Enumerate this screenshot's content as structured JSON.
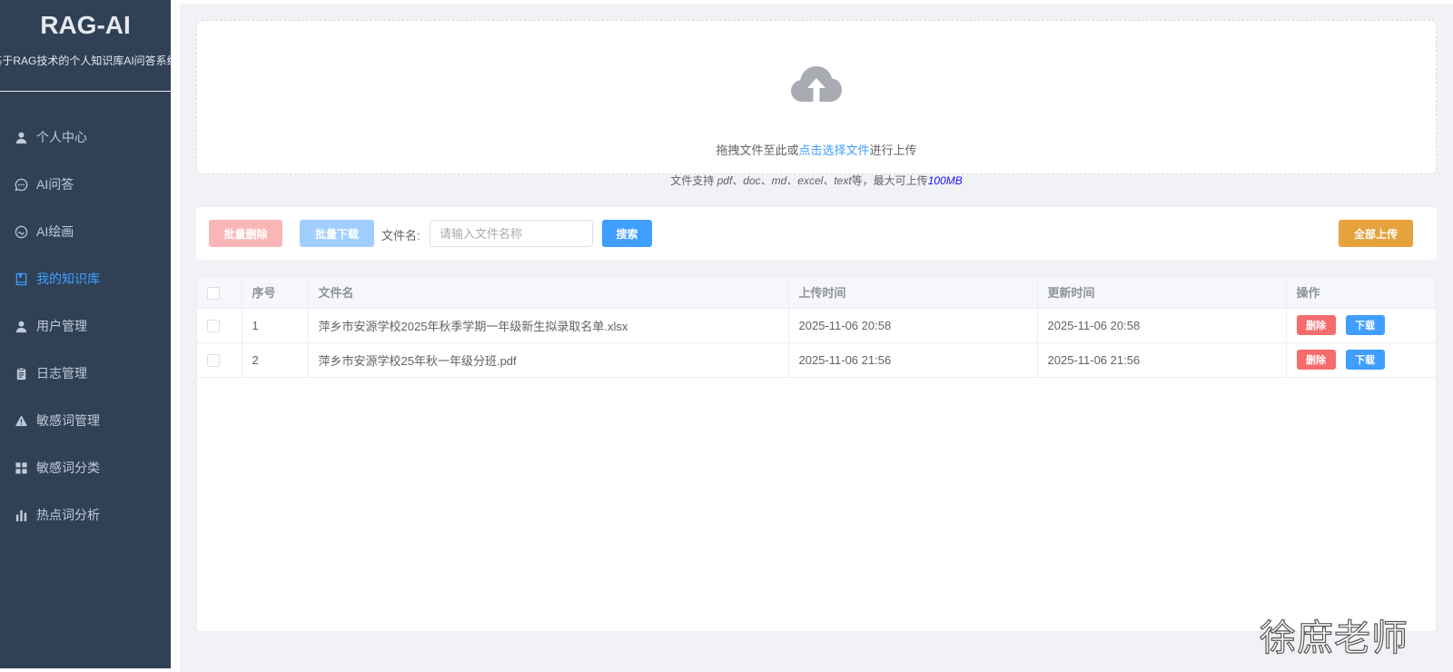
{
  "brand": {
    "title": "RAG-AI",
    "subtitle": "基于RAG技术的个人知识库AI问答系统"
  },
  "sidebar": {
    "items": [
      {
        "label": "个人中心",
        "icon": "user-icon",
        "active": false
      },
      {
        "label": "AI问答",
        "icon": "chat-icon",
        "active": false
      },
      {
        "label": "AI绘画",
        "icon": "palette-icon",
        "active": false
      },
      {
        "label": "我的知识库",
        "icon": "book-icon",
        "active": true
      },
      {
        "label": "用户管理",
        "icon": "user-icon",
        "active": false
      },
      {
        "label": "日志管理",
        "icon": "clipboard-icon",
        "active": false
      },
      {
        "label": "敏感词管理",
        "icon": "warning-icon",
        "active": false
      },
      {
        "label": "敏感词分类",
        "icon": "grid-icon",
        "active": false
      },
      {
        "label": "热点词分析",
        "icon": "bar-chart-icon",
        "active": false
      }
    ]
  },
  "upload": {
    "text_before": "拖拽文件至此或",
    "link": "点击选择文件",
    "text_after": "进行上传",
    "tip_prefix": "文件支持 ",
    "tip_types": "pdf、doc、md、excel、text",
    "tip_mid": "等，最大可上传",
    "tip_max": "100MB"
  },
  "toolbar": {
    "batch_delete": "批量删除",
    "batch_download": "批量下载",
    "filename_label": "文件名:",
    "search_placeholder": "请输入文件名称",
    "search": "搜索",
    "upload_all": "全部上传"
  },
  "table": {
    "headers": {
      "index": "序号",
      "filename": "文件名",
      "upload_time": "上传时间",
      "update_time": "更新时间",
      "actions": "操作"
    },
    "rows": [
      {
        "index": "1",
        "filename": "萍乡市安源学校2025年秋季学期一年级新生拟录取名单.xlsx",
        "upload_time": "2025-11-06 20:58",
        "update_time": "2025-11-06 20:58"
      },
      {
        "index": "2",
        "filename": "萍乡市安源学校25年秋一年级分班.pdf",
        "upload_time": "2025-11-06 21:56",
        "update_time": "2025-11-06 21:56"
      }
    ],
    "row_delete": "删除",
    "row_download": "下载"
  },
  "watermark": "徐庶老师",
  "colors": {
    "sidebar_bg": "#304156",
    "active": "#409eff",
    "danger": "#f56c6c",
    "warning": "#e6a23c"
  }
}
